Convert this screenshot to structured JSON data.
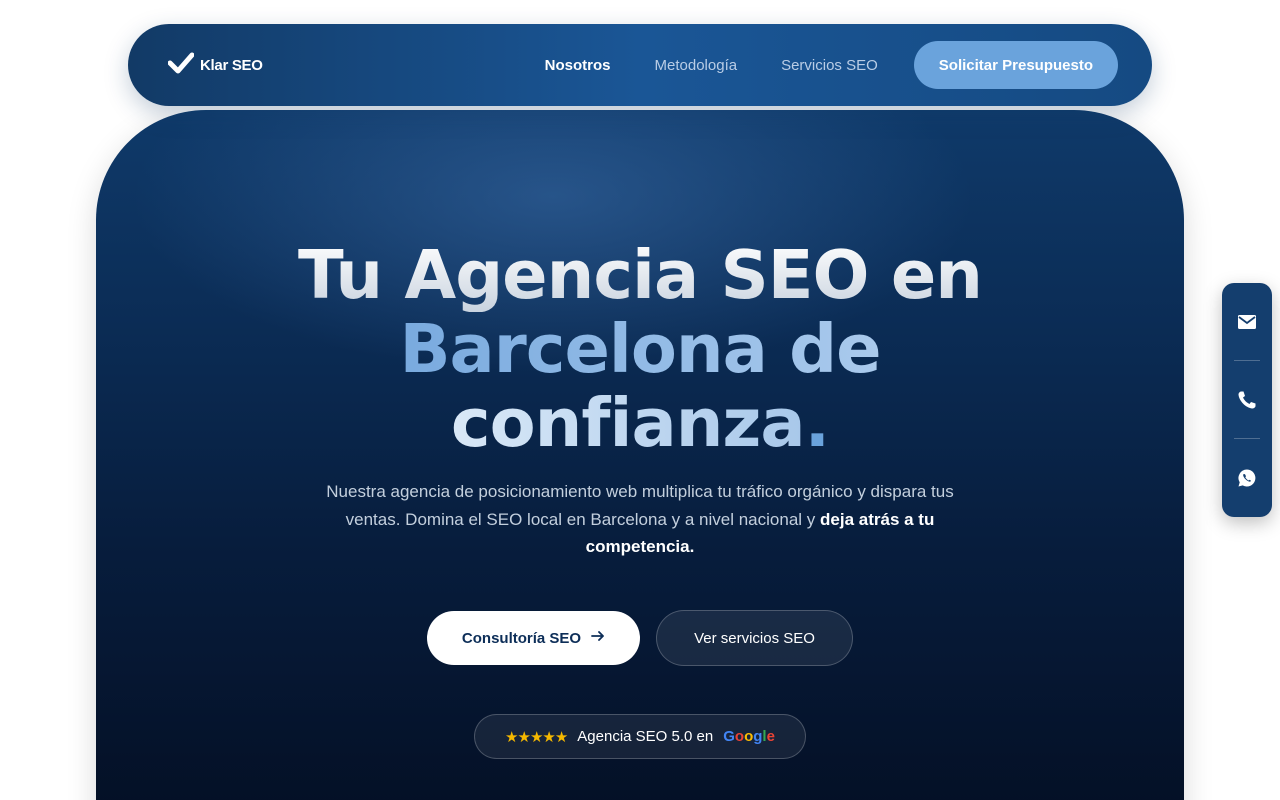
{
  "header": {
    "logo_text": "Klar SEO",
    "nav": [
      {
        "label": "Nosotros",
        "active": true
      },
      {
        "label": "Metodología",
        "active": false
      },
      {
        "label": "Servicios SEO",
        "active": false
      }
    ],
    "cta_label": "Solicitar Presupuesto"
  },
  "hero": {
    "headline": {
      "line1": "Tu Agencia SEO en",
      "line2": "Barcelona de",
      "line3": "confianza",
      "line3_dot": "."
    },
    "subtitle": {
      "text": "Nuestra agencia de posicionamiento web multiplica tu tráfico orgánico y dispara tus ventas. Domina el SEO local en Barcelona y a nivel nacional y ",
      "strong": "deja atrás a tu competencia."
    },
    "primary_button": "Consultoría SEO",
    "secondary_button": "Ver servicios SEO",
    "rating": {
      "stars": "★★★★★",
      "text": "Agencia SEO 5.0 en",
      "google": [
        "G",
        "o",
        "o",
        "g",
        "l",
        "e"
      ]
    }
  },
  "contact_bar": {
    "icons": [
      "mail-icon",
      "phone-icon",
      "whatsapp-icon"
    ]
  },
  "colors": {
    "nav_bg": "#1a5696",
    "cta_bg": "#6aa3dc",
    "hero_bg": "#0b2c55",
    "accent_blue": "#6aa3dc",
    "star": "#f5b800"
  }
}
